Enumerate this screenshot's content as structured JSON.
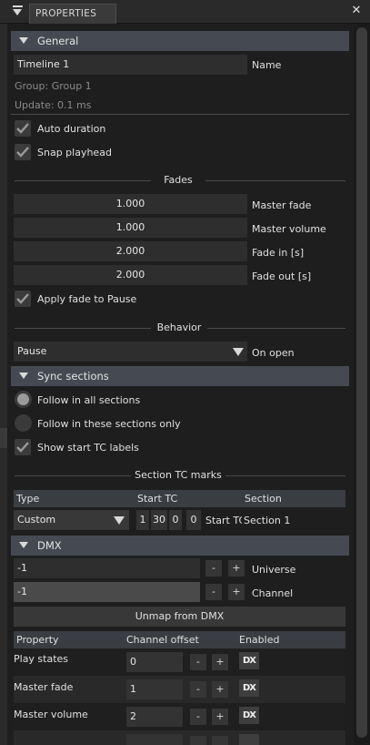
{
  "window": {
    "tab_label": "PROPERTIES",
    "close": "✕"
  },
  "general": {
    "header": "General",
    "name_value": "Timeline 1",
    "name_label": "Name",
    "group": "Group: Group 1",
    "update": "Update: 0.1 ms",
    "auto_duration": {
      "label": "Auto duration",
      "checked": true
    },
    "snap_playhead": {
      "label": "Snap playhead",
      "checked": true
    }
  },
  "fades": {
    "title": "Fades",
    "master_fade": {
      "value": "1.000",
      "label": "Master fade"
    },
    "master_volume": {
      "value": "1.000",
      "label": "Master volume"
    },
    "fade_in": {
      "value": "2.000",
      "label": "Fade in [s]"
    },
    "fade_out": {
      "value": "2.000",
      "label": "Fade out [s]"
    },
    "apply_fade_to_pause": {
      "label": "Apply fade to Pause",
      "checked": true
    }
  },
  "behavior": {
    "title": "Behavior",
    "on_open_value": "Pause",
    "on_open_label": "On open"
  },
  "sync_sections": {
    "header": "Sync sections",
    "follow_all": {
      "label": "Follow in all sections",
      "selected": true
    },
    "follow_these": {
      "label": "Follow in these sections only",
      "selected": false
    },
    "show_start_tc": {
      "label": "Show start TC labels",
      "checked": true
    }
  },
  "section_tc_marks": {
    "title": "Section TC marks",
    "columns": [
      "Type",
      "Start TC",
      "Section"
    ],
    "row": {
      "type": "Custom",
      "tc": [
        "1",
        "30",
        "0",
        "0"
      ],
      "start_tc_label": "Start TC",
      "section": "Section 1"
    }
  },
  "dmx": {
    "header": "DMX",
    "universe": {
      "value": "-1",
      "label": "Universe",
      "minus": "-",
      "plus": "+"
    },
    "channel": {
      "value": "-1",
      "label": "Channel",
      "minus": "-",
      "plus": "+"
    },
    "unmap_button": "Unmap from DMX",
    "table_columns": [
      "Property",
      "Channel offset",
      "Enabled"
    ],
    "rows": [
      {
        "property": "Play states",
        "offset": "0",
        "minus": "-",
        "plus": "+",
        "icon": "DX"
      },
      {
        "property": "Master fade",
        "offset": "1",
        "minus": "-",
        "plus": "+",
        "icon": "DX"
      },
      {
        "property": "Master volume",
        "offset": "2",
        "minus": "-",
        "plus": "+",
        "icon": "DX"
      }
    ]
  }
}
